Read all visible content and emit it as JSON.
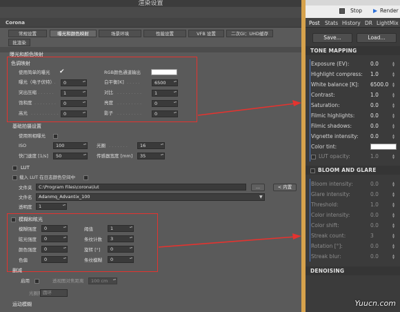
{
  "window": {
    "title": "渲染设置",
    "renderer": "Corona"
  },
  "tabs": [
    {
      "label": "常规设置"
    },
    {
      "label": "曝光和颜色映射",
      "active": true
    },
    {
      "label": "场景环境"
    },
    {
      "label": "性能设置"
    },
    {
      "label": "VFB 设置"
    },
    {
      "label": "二次GI：UHD缓存"
    },
    {
      "label": "批渲染"
    }
  ],
  "exposure_section": {
    "title": "曝光和颜色映射"
  },
  "color_mapping": {
    "title": "色调映射",
    "use_simple_exposure": {
      "label": "使用简单的曝光",
      "checked": true
    },
    "rgb_channel": {
      "label": "RGB颜色通道输出",
      "color": "#ffffff"
    },
    "exposure": {
      "label": "曝光（电子伏特）",
      "value": "0"
    },
    "white_balance": {
      "label": "白平衡[K]",
      "value": "6500"
    },
    "highlight_compress": {
      "label": "突出压缩",
      "value": "1"
    },
    "contrast": {
      "label": "对比",
      "value": "1"
    },
    "saturation": {
      "label": "饱和度",
      "value": "0"
    },
    "brightness": {
      "label": "亮度",
      "value": "0"
    },
    "highlight": {
      "label": "高光",
      "value": "0"
    },
    "shadow": {
      "label": "影子",
      "value": "0"
    }
  },
  "camera": {
    "title": "基础拍摄设置",
    "use_photo_exposure": {
      "label": "使用照相曝光"
    },
    "iso": {
      "label": "ISO",
      "value": "100"
    },
    "fstop": {
      "label": "光圈",
      "value": "16"
    },
    "shutter": {
      "label": "快门速度 [1/s]",
      "value": "50"
    },
    "sensor": {
      "label": "传感器宽度 [mm]",
      "value": "35"
    }
  },
  "lut": {
    "title": "LUT",
    "enable_label": "载入 LUT 在日志颜色空间中",
    "folder_label": "文件夹",
    "folder_path": "C:\\Program Files\\corona\\lut",
    "browse": "...",
    "builtin": "< 内置",
    "file_label": "文件名",
    "file_value": "Adanmq_Advantix_100",
    "opacity_label": "透明度",
    "opacity_value": "1"
  },
  "bloom": {
    "title": "模糊和眩光",
    "bloom_intensity": {
      "label": "模糊强度",
      "value": "0"
    },
    "threshold": {
      "label": "阈值",
      "value": "1"
    },
    "glare_intensity": {
      "label": "眩光强度",
      "value": "0"
    },
    "streak_count": {
      "label": "条纹计数",
      "value": "3"
    },
    "color_intensity": {
      "label": "颜色强度",
      "value": "0"
    },
    "rotation": {
      "label": "旋转 [°]",
      "value": "0"
    },
    "color_shift": {
      "label": "色偏",
      "value": "0"
    },
    "streak_blur": {
      "label": "条纹模糊",
      "value": "0"
    }
  },
  "denoise": {
    "title": "删减",
    "enable": "启用",
    "only_from": "透视图对焦距离",
    "distance": "100 cm",
    "shape_label": "光圈形状",
    "shape_value": "圆环"
  },
  "motion_blur": {
    "title": "运动模糊"
  },
  "right_panel": {
    "stop": "Stop",
    "render": "Render",
    "tabs": [
      "Post",
      "Stats",
      "History",
      "DR",
      "LightMix"
    ],
    "save": "Save...",
    "load": "Load...",
    "tone_mapping": {
      "title": "TONE MAPPING",
      "rows": [
        {
          "label": "Exposure (EV):",
          "value": "0.0"
        },
        {
          "label": "Highlight compress:",
          "value": "1.0"
        },
        {
          "label": "White balance [K]:",
          "value": "6500.0"
        },
        {
          "label": "Contrast:",
          "value": "1.0"
        },
        {
          "label": "Saturation:",
          "value": "0.0"
        },
        {
          "label": "Filmic highlights:",
          "value": "0.0"
        },
        {
          "label": "Filmic shadows:",
          "value": "0.0"
        },
        {
          "label": "Vignette intensity:",
          "value": "0.0"
        }
      ],
      "color_tint": "Color tint:",
      "lut_opacity": {
        "label": "LUT opacity:",
        "value": "1.0"
      }
    },
    "bloom_glare": {
      "title": "BLOOM AND GLARE",
      "rows": [
        {
          "label": "Bloom intensity:",
          "value": "0.0"
        },
        {
          "label": "Glare intensity:",
          "value": "0.0"
        },
        {
          "label": "Threshold:",
          "value": "1.0"
        },
        {
          "label": "Color intensity:",
          "value": "0.0"
        },
        {
          "label": "Color shift:",
          "value": "0.0"
        },
        {
          "label": "Streak count:",
          "value": "3"
        },
        {
          "label": "Rotation [°]:",
          "value": "0.0"
        },
        {
          "label": "Streak blur:",
          "value": "0.0"
        }
      ]
    },
    "denoising": {
      "title": "DENOISING"
    }
  },
  "watermark": "Yuucn.com",
  "colors": {
    "highlight_box": "#e5332f",
    "arrow": "#e5332f",
    "panel_divider": "#d6a24c",
    "render_accent": "#2c6fd9"
  }
}
